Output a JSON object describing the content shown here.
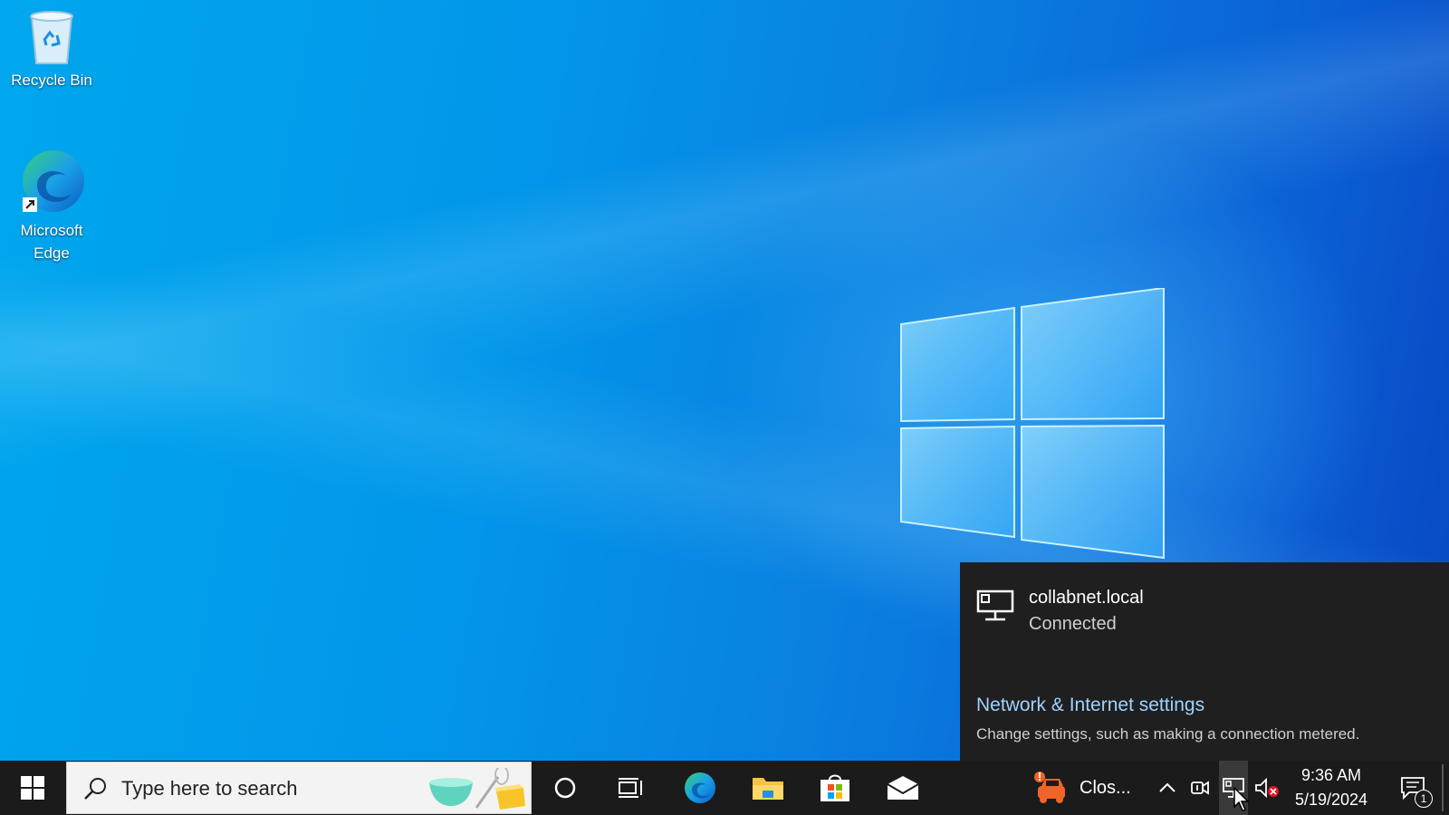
{
  "desktop": {
    "icons": [
      {
        "label": "Recycle Bin",
        "icon": "recycle-bin-icon"
      },
      {
        "label": "Microsoft\nEdge",
        "icon": "edge-icon"
      }
    ]
  },
  "network_flyout": {
    "network_name": "collabnet.local",
    "status": "Connected",
    "settings_link": "Network & Internet settings",
    "settings_description": "Change settings, such as making a connection metered."
  },
  "taskbar": {
    "search_placeholder": "Type here to search",
    "pinned": [
      "cortana-icon",
      "task-view-icon",
      "edge-icon",
      "file-explorer-icon",
      "store-icon",
      "mail-icon"
    ],
    "running_app_label": "Clos...",
    "clock_time": "9:36 AM",
    "clock_date": "5/19/2024",
    "notification_count": "1"
  },
  "colors": {
    "taskbar": "#1b1b1b",
    "flyout": "#1f1f1f",
    "link": "#9fd2ff",
    "desktop_accent": "#0a7fe0"
  }
}
